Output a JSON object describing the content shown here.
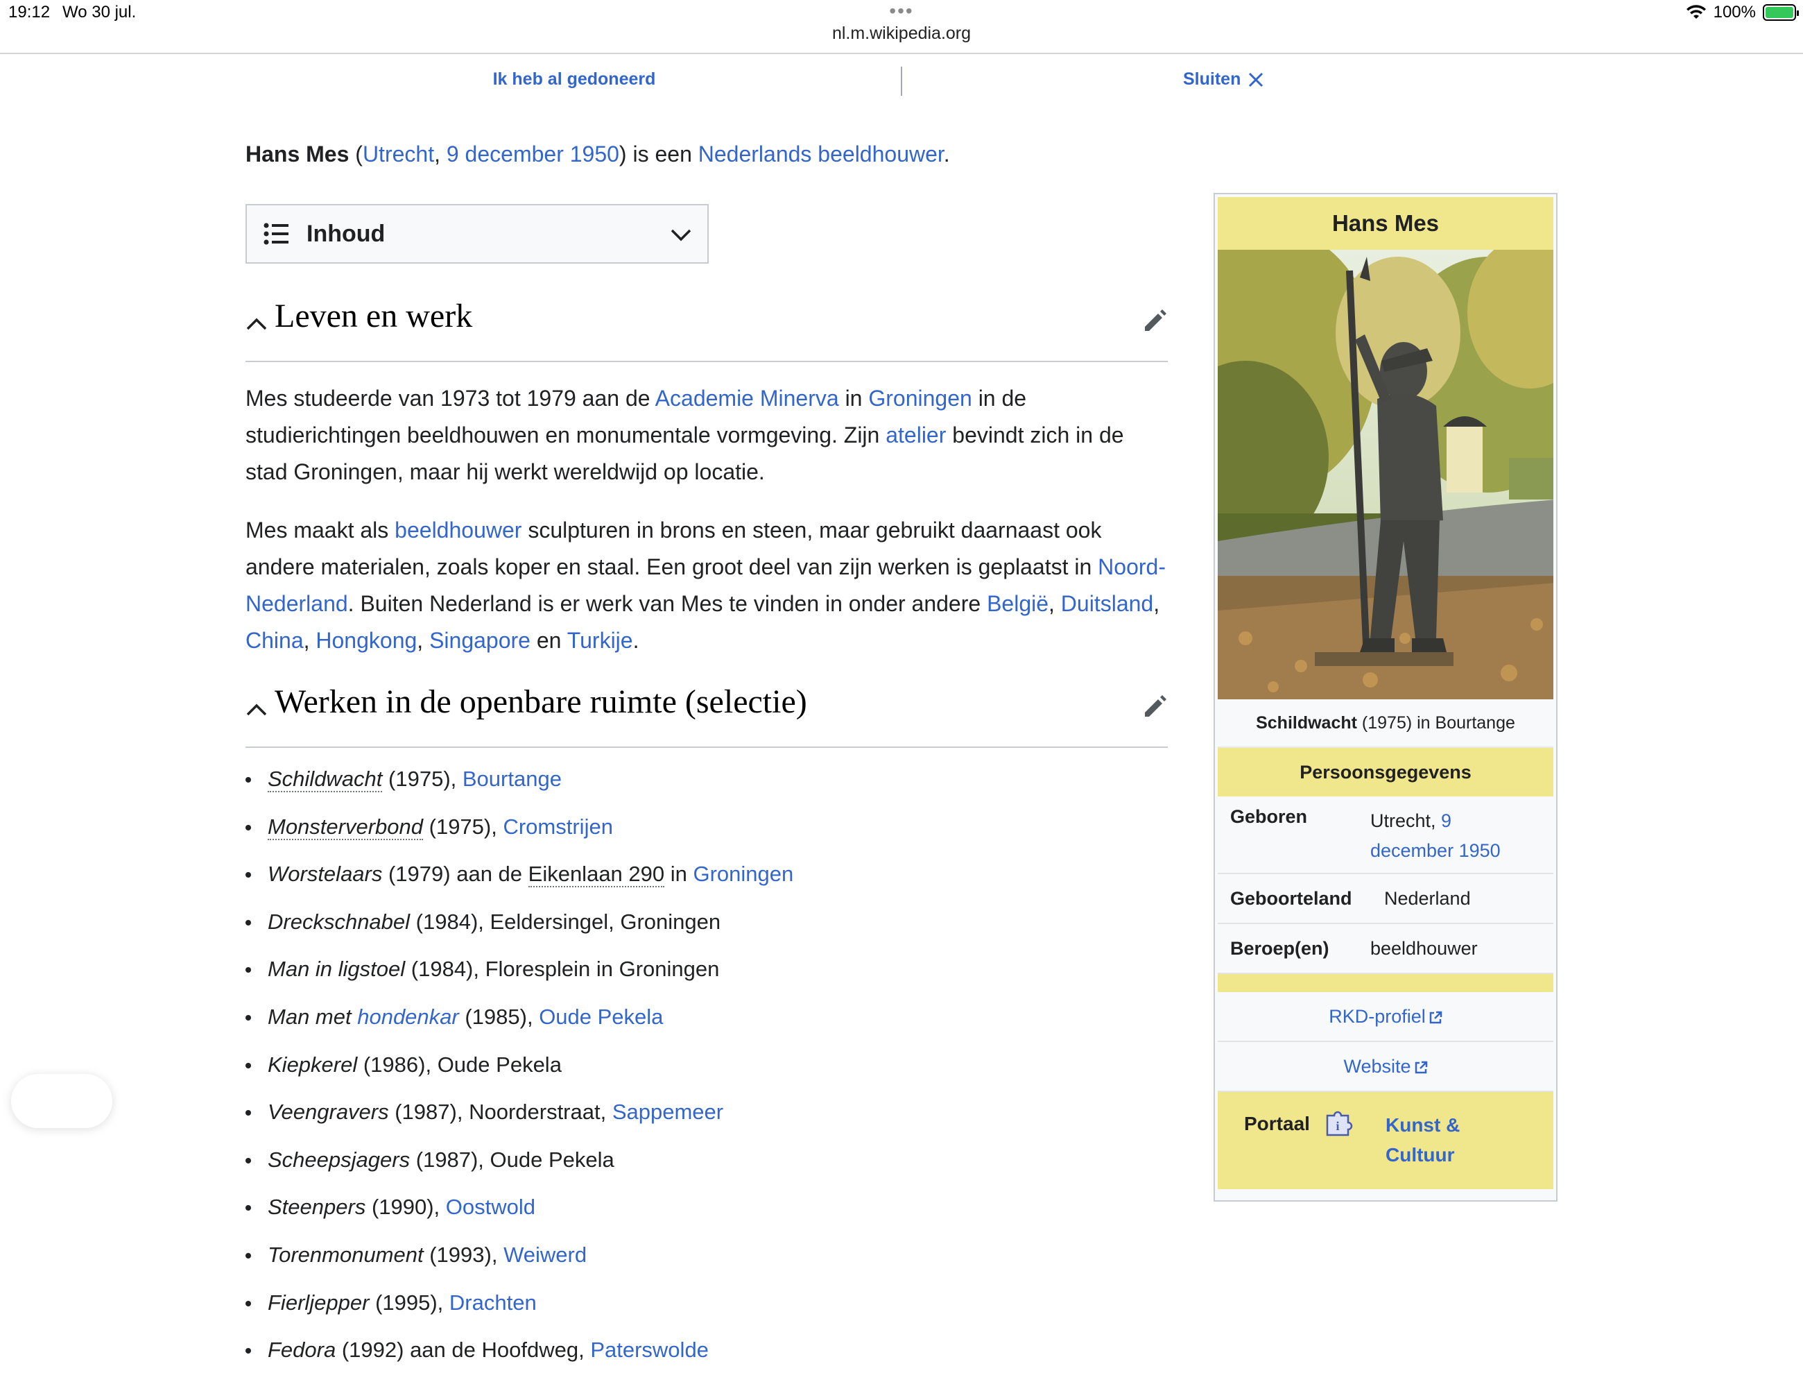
{
  "status_bar": {
    "time": "19:12",
    "date": "Wo 30 jul.",
    "url": "nl.m.wikipedia.org",
    "battery": "100%",
    "battery_level": 1.0
  },
  "banner": {
    "donated_label": "Ik heb al gedoneerd",
    "close_label": "Sluiten"
  },
  "lead": {
    "name": "Hans Mes",
    "place": "Utrecht",
    "date": "9 december 1950",
    "middle": "is een",
    "profession": "Nederlands beeldhouwer"
  },
  "toc": {
    "label": "Inhoud"
  },
  "sections": [
    {
      "title": "Leven en werk"
    },
    {
      "title": "Werken in de openbare ruimte (selectie)"
    }
  ],
  "para1": {
    "t1": "Mes studeerde van 1973 tot 1979 aan de ",
    "l1": "Academie Minerva",
    "t2": " in ",
    "l2": "Groningen",
    "t3": " in de studierichtingen beeldhouwen en monumentale vormgeving. Zijn ",
    "l3": "atelier",
    "t4": " bevindt zich in de stad Groningen, maar hij werkt wereldwijd op locatie."
  },
  "para2": {
    "t1": "Mes maakt als ",
    "l1": "beeldhouwer",
    "t2": " sculpturen in brons en steen, maar gebruikt daarnaast ook andere materialen, zoals koper en staal. Een groot deel van zijn werken is geplaatst in ",
    "l2": "Noord-Nederland",
    "t3": ". Buiten Nederland is er werk van Mes te vinden in onder andere ",
    "l3": "België",
    "t4": ", ",
    "l4": "Duitsland",
    "t5": ", ",
    "l5": "China",
    "t6": ", ",
    "l6": "Hongkong",
    "t7": ", ",
    "l7": "Singapore",
    "t8": " en ",
    "l8": "Turkije",
    "t9": "."
  },
  "works": [
    {
      "title": "Schildwacht",
      "rest": " (1975), ",
      "link": "Bourtange"
    },
    {
      "title": "Monsterverbond",
      "rest": " (1975), ",
      "link": "Cromstrijen"
    },
    {
      "title": "Worstelaars",
      "rest": " (1979) aan de ",
      "link2": "Eikenlaan 290",
      "rest2": " in ",
      "link": "Groningen"
    },
    {
      "title": "Dreckschnabel",
      "rest": " (1984), Eeldersingel, Groningen"
    },
    {
      "title": "Man in ligstoel",
      "rest": " (1984), Floresplein in Groningen"
    },
    {
      "title": "Man met ",
      "title_link": "hondenkar",
      "rest": " (1985), ",
      "link": "Oude Pekela"
    },
    {
      "title": "Kiepkerel",
      "rest": " (1986), Oude Pekela"
    },
    {
      "title": "Veengravers",
      "rest": " (1987), Noorderstraat, ",
      "link": "Sappemeer"
    },
    {
      "title": "Scheepsjagers",
      "rest": " (1987), Oude Pekela"
    },
    {
      "title": "Steenpers",
      "rest": " (1990), ",
      "link": "Oostwold"
    },
    {
      "title": "Torenmonument",
      "rest": " (1993), ",
      "link": "Weiwerd"
    },
    {
      "title": "Fierljepper",
      "rest": " (1995), ",
      "link": "Drachten"
    },
    {
      "title": "Fedora",
      "rest": " (1992) aan de Hoofdweg, ",
      "link": "Paterswolde"
    }
  ],
  "infobox": {
    "title": "Hans Mes",
    "caption_bold": "Schildwacht",
    "caption_rest": " (1975) in Bourtange",
    "header": "Persoonsgegevens",
    "rows": [
      {
        "key": "Geboren",
        "value": "Utrecht, ",
        "value_link": "9 december 1950"
      },
      {
        "key": "Geboorteland",
        "value_link": "Nederland"
      },
      {
        "key": "Beroep(en)",
        "value_link": "beeldhouwer"
      }
    ],
    "links": [
      "RKD-profiel",
      "Website"
    ],
    "portal_label": "Portaal",
    "portal_link": "Kunst & Cultuur",
    "colors": {
      "header_bg": "#f0e68c",
      "link": "#3366cc"
    }
  },
  "icons": {
    "toc": "list-icon",
    "toc_toggle": "chevron-down-icon",
    "section_toggle": "chevron-up-icon",
    "edit": "pencil-icon",
    "close": "close-icon",
    "external": "external-link-icon",
    "portal": "puzzle-icon"
  }
}
